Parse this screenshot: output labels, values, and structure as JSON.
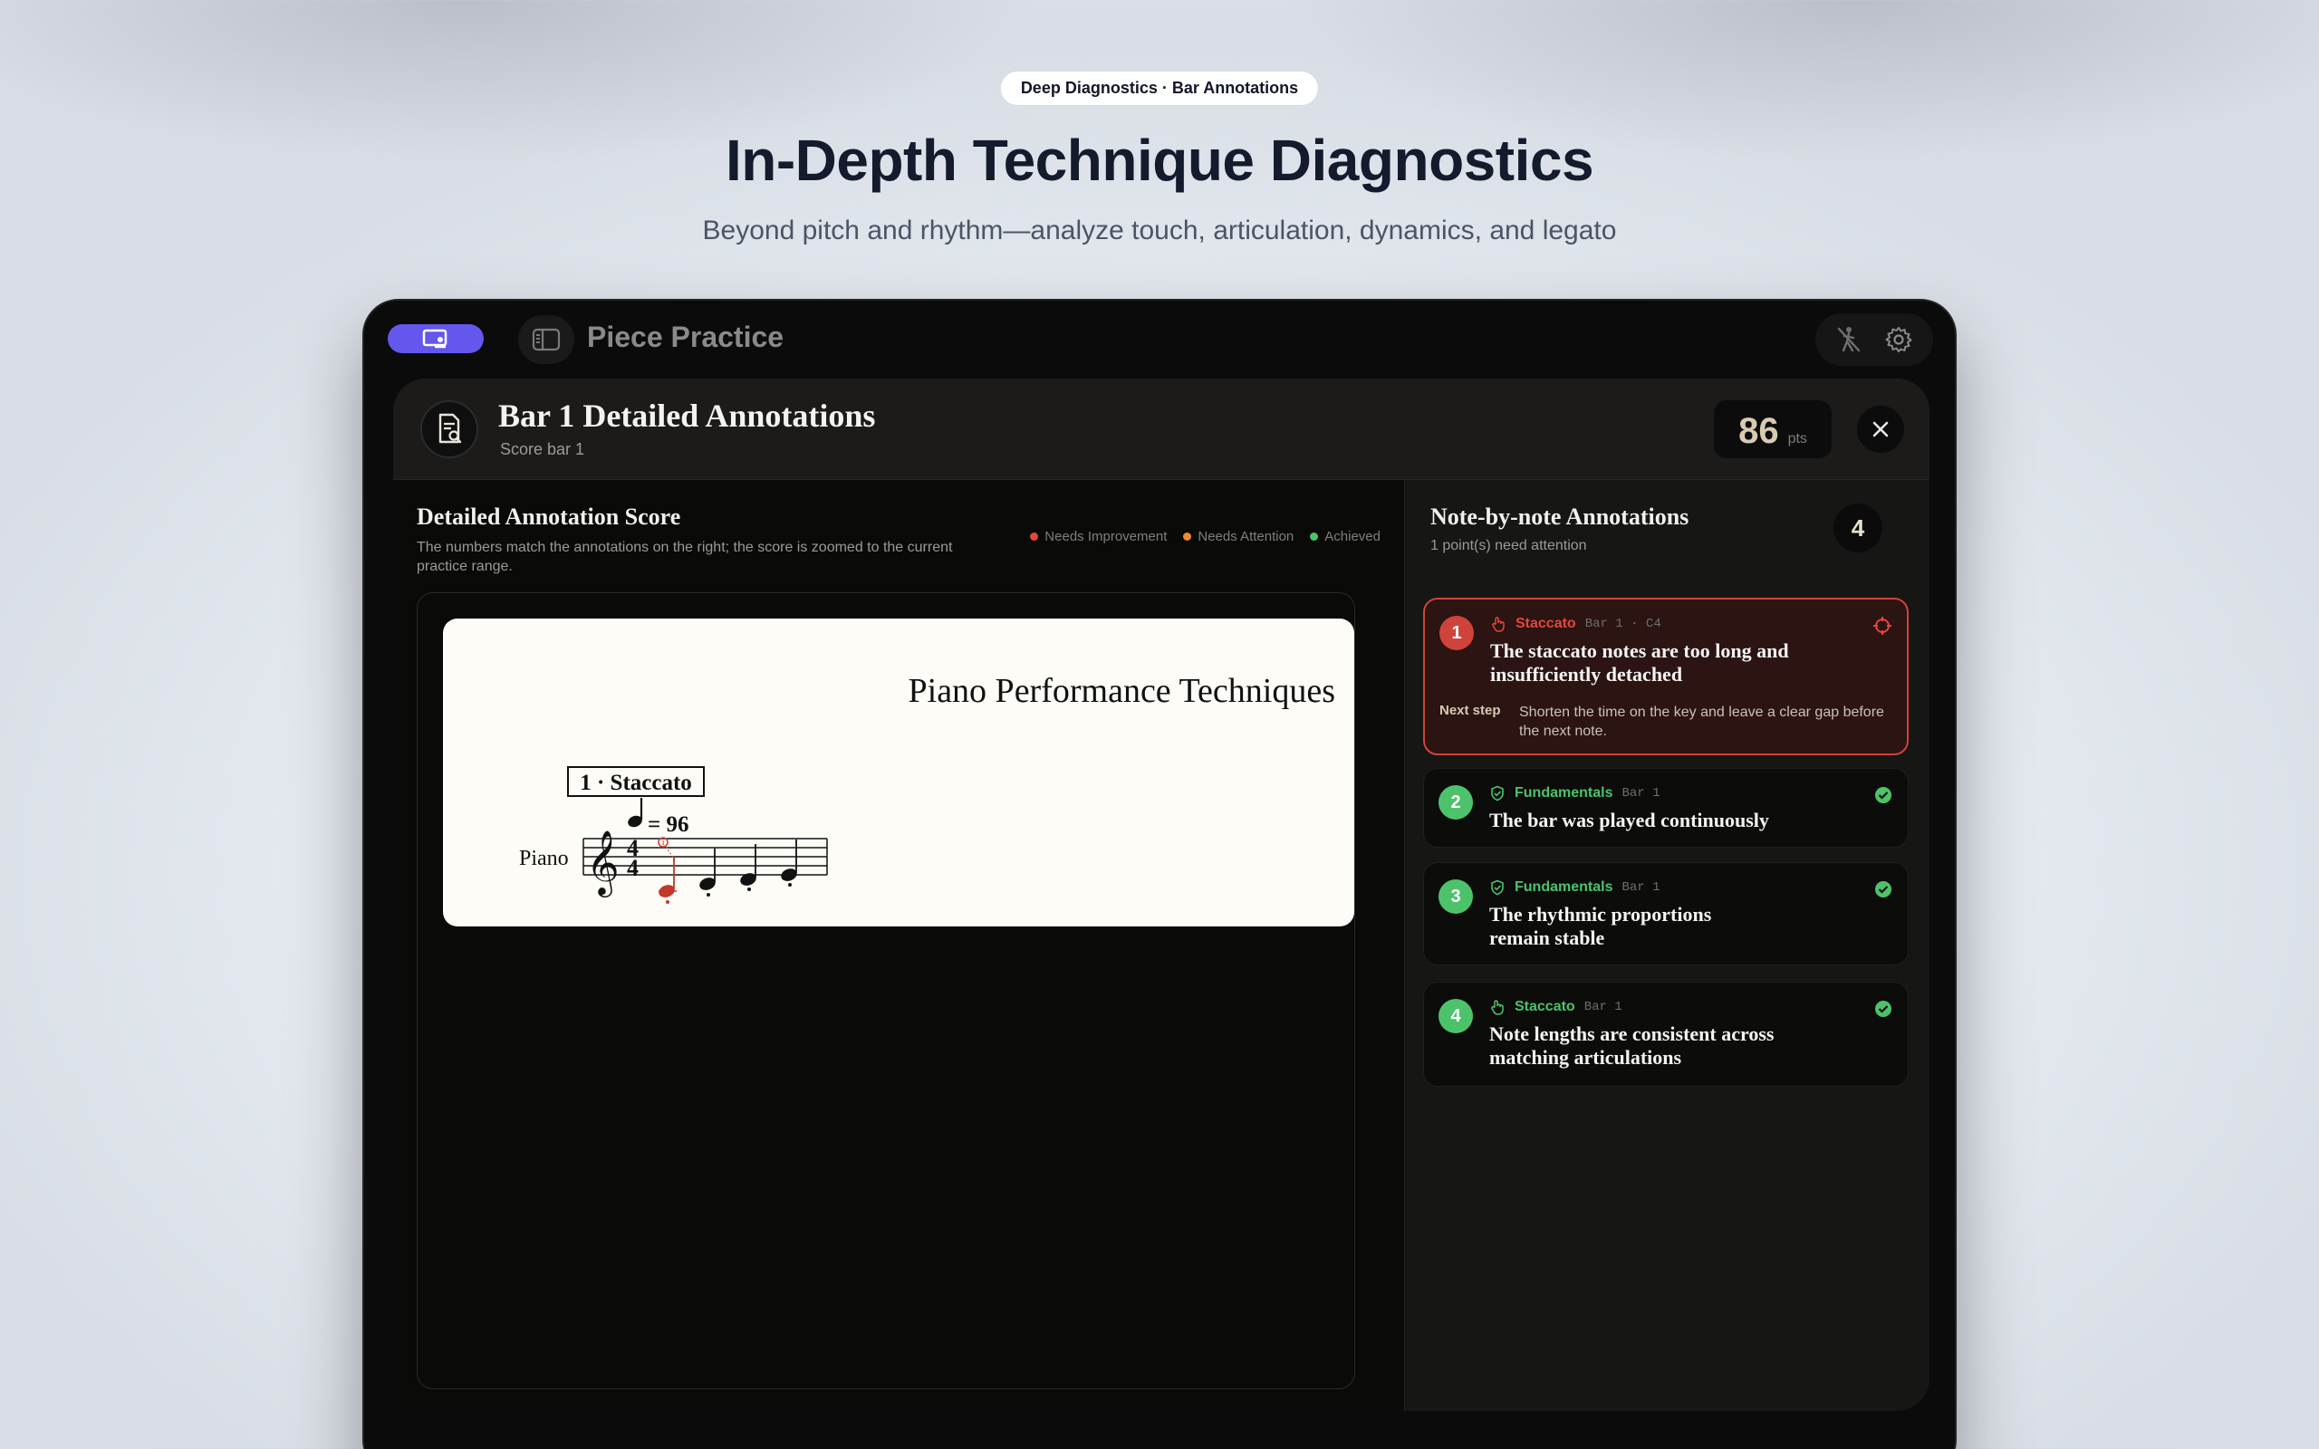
{
  "hero": {
    "badge": "Deep Diagnostics · Bar Annotations",
    "title": "In-Depth Technique Diagnostics",
    "subtitle": "Beyond pitch and rhythm—analyze touch, articulation, dynamics, and legato"
  },
  "app": {
    "title": "Piece Practice",
    "accent": "#6457ee"
  },
  "panel": {
    "title": "Bar 1 Detailed Annotations",
    "subtitle": "Score bar 1",
    "score": "86",
    "score_unit": "pts"
  },
  "score_view": {
    "title": "Detailed Annotation Score",
    "description": "The numbers match the annotations on the right; the score is zoomed to the current practice range.",
    "legend": [
      {
        "label": "Needs Improvement",
        "color": "#e2473c"
      },
      {
        "label": "Needs Attention",
        "color": "#f08a2c"
      },
      {
        "label": "Achieved",
        "color": "#4cc36a"
      }
    ],
    "sheet": {
      "piece_title": "Piano Performance Techniques",
      "rehearsal_mark": "1 · Staccato",
      "tempo": "= 96",
      "instrument": "Piano",
      "time_signature_top": "4",
      "time_signature_bottom": "4",
      "marker_number": "1"
    }
  },
  "annotations": {
    "title": "Note-by-note Annotations",
    "subtitle": "1 point(s) need attention",
    "count": "4",
    "next_step_label": "Next step",
    "items": [
      {
        "num": "1",
        "category": "Staccato",
        "location": "Bar 1 · C4",
        "title": "The staccato notes are too long and insufficiently detached",
        "next_step": "Shorten the time on the key and leave a clear gap before the next note.",
        "status": "needs-improvement",
        "color": "#e2473c",
        "icon": "hand-touch-icon"
      },
      {
        "num": "2",
        "category": "Fundamentals",
        "location": "Bar 1",
        "title": "The bar was played continuously",
        "status": "achieved",
        "color": "#4cc36a",
        "icon": "shield-check-icon"
      },
      {
        "num": "3",
        "category": "Fundamentals",
        "location": "Bar 1",
        "title": "The rhythmic proportions remain stable",
        "status": "achieved",
        "color": "#4cc36a",
        "icon": "shield-check-icon"
      },
      {
        "num": "4",
        "category": "Staccato",
        "location": "Bar 1",
        "title": "Note lengths are consistent across matching articulations",
        "status": "achieved",
        "color": "#4cc36a",
        "icon": "hand-touch-icon"
      }
    ]
  }
}
